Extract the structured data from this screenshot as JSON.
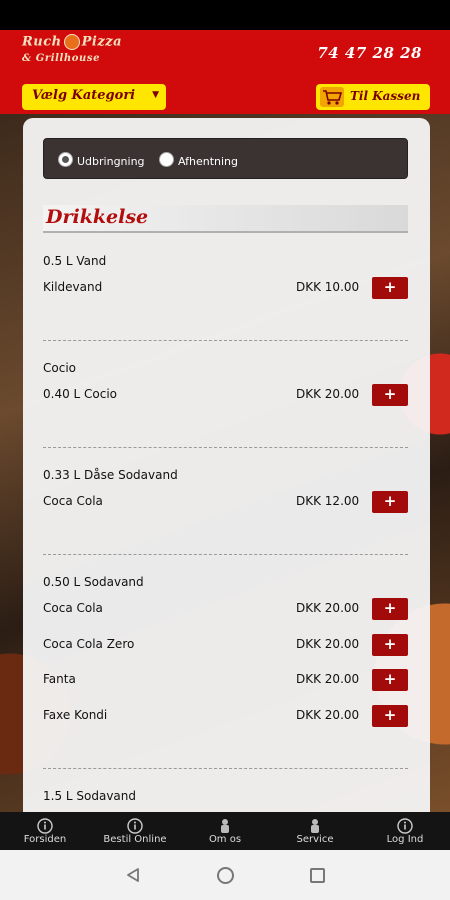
{
  "header": {
    "logo_line1_a": "Ruch",
    "logo_line1_b": "Pizza",
    "logo_line2": "& Grillhouse",
    "phone": "74 47 28 28",
    "category_select": "Vælg Kategori",
    "checkout_button": "Til Kassen"
  },
  "delivery": {
    "option1": "Udbringning",
    "option2": "Afhentning",
    "selected": "Udbringning"
  },
  "section": {
    "title": "Drikkelse"
  },
  "groups": [
    {
      "title": "0.5 L Vand",
      "items": [
        {
          "name": "Kildevand",
          "price": "DKK 10.00"
        }
      ]
    },
    {
      "title": "Cocio",
      "items": [
        {
          "name": "0.40 L Cocio",
          "price": "DKK 20.00"
        }
      ]
    },
    {
      "title": "0.33 L Dåse Sodavand",
      "items": [
        {
          "name": "Coca Cola",
          "price": "DKK 12.00"
        }
      ]
    },
    {
      "title": "0.50 L Sodavand",
      "items": [
        {
          "name": "Coca Cola",
          "price": "DKK 20.00"
        },
        {
          "name": "Coca Cola Zero",
          "price": "DKK 20.00"
        },
        {
          "name": "Fanta",
          "price": "DKK 20.00"
        },
        {
          "name": "Faxe Kondi",
          "price": "DKK 20.00"
        }
      ]
    },
    {
      "title": "1.5 L Sodavand",
      "items": []
    }
  ],
  "add_label": "+",
  "bottom_nav": [
    {
      "label": "Forsiden",
      "icon": "info-icon"
    },
    {
      "label": "Bestil Online",
      "icon": "info-icon"
    },
    {
      "label": "Om os",
      "icon": "chef-icon"
    },
    {
      "label": "Service",
      "icon": "chef-icon"
    },
    {
      "label": "Log Ind",
      "icon": "info-icon"
    }
  ],
  "colors": {
    "brand_red": "#d10b0b",
    "accent_yellow": "#ffe600",
    "button_red": "#a30b0b"
  }
}
